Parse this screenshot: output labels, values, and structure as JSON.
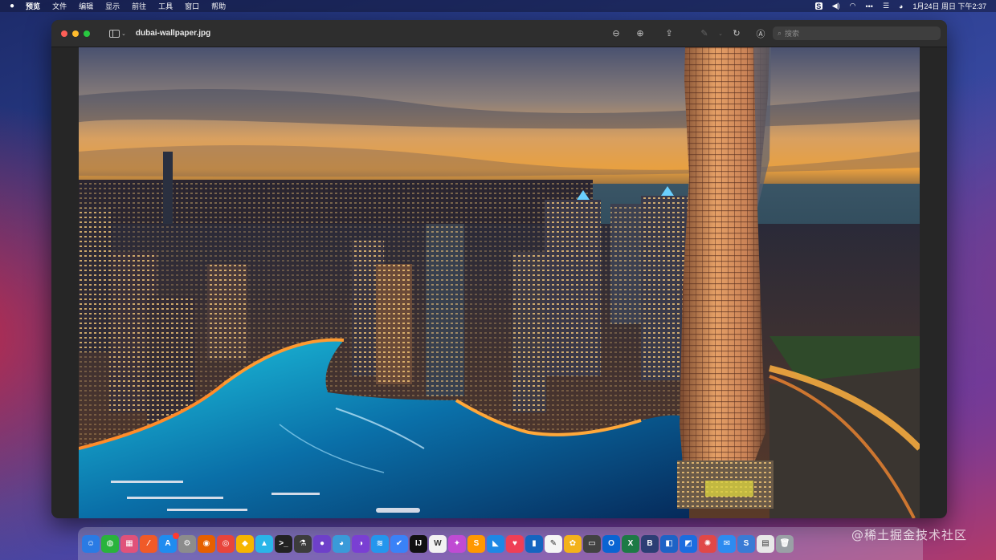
{
  "menubar": {
    "items": [
      "预览",
      "文件",
      "编辑",
      "显示",
      "前往",
      "工具",
      "窗口",
      "帮助"
    ],
    "clock": "1月24日 周日 下午2:37",
    "status_icons": [
      "s-menu-icon",
      "volume-icon",
      "wifi-icon",
      "more-dots-icon",
      "control-center-icon",
      "siri-icon"
    ]
  },
  "window": {
    "title": "dubai-wallpaper.jpg",
    "toolbar": {
      "zoom_out": "⊖",
      "zoom_in": "⊕",
      "share": "⇪",
      "markup": "✎",
      "rotate": "↻",
      "annotate": "Ⓐ"
    },
    "search": {
      "placeholder": "搜索"
    }
  },
  "dock": {
    "items": [
      {
        "name": "finder",
        "glyph": "☺",
        "color": "#2a7be4"
      },
      {
        "name": "wechat",
        "glyph": "◍",
        "color": "#29b33c"
      },
      {
        "name": "launchpad",
        "glyph": "▦",
        "color": "#e0527a"
      },
      {
        "name": "swift-playgrounds",
        "glyph": "⁄",
        "color": "#f05a28"
      },
      {
        "name": "app-store",
        "glyph": "A",
        "color": "#1f8cf0"
      },
      {
        "name": "system-preferences",
        "glyph": "⚙",
        "color": "#8c8c8c"
      },
      {
        "name": "firefox",
        "glyph": "◉",
        "color": "#e66000"
      },
      {
        "name": "chrome",
        "glyph": "◎",
        "color": "#e8453c"
      },
      {
        "name": "sketch",
        "glyph": "◆",
        "color": "#f7b500"
      },
      {
        "name": "affinity",
        "glyph": "▲",
        "color": "#2ab5e8"
      },
      {
        "name": "terminal",
        "glyph": ">_",
        "color": "#222222"
      },
      {
        "name": "flask",
        "glyph": "⚗",
        "color": "#3c3c3c"
      },
      {
        "name": "github",
        "glyph": "●",
        "color": "#6e40c9"
      },
      {
        "name": "qq",
        "glyph": "◕",
        "color": "#3a9ad9"
      },
      {
        "name": "firefox-dev",
        "glyph": "◑",
        "color": "#7a3fd3"
      },
      {
        "name": "docker",
        "glyph": "≋",
        "color": "#2496ed"
      },
      {
        "name": "things",
        "glyph": "✔",
        "color": "#3a82f7"
      },
      {
        "name": "intellij",
        "glyph": "IJ",
        "color": "#111111"
      },
      {
        "name": "typora",
        "glyph": "W",
        "color": "#f2f2f2"
      },
      {
        "name": "nova",
        "glyph": "✦",
        "color": "#c04bd3"
      },
      {
        "name": "sublime",
        "glyph": "S",
        "color": "#ff9800"
      },
      {
        "name": "vscode",
        "glyph": "◣",
        "color": "#1e88e5"
      },
      {
        "name": "pocket",
        "glyph": "♥",
        "color": "#ef3f56"
      },
      {
        "name": "bookmarks",
        "glyph": "▮",
        "color": "#1565c0"
      },
      {
        "name": "notes",
        "glyph": "✎",
        "color": "#f5f5f5"
      },
      {
        "name": "tes",
        "glyph": "✿",
        "color": "#f3b21b"
      },
      {
        "name": "screen",
        "glyph": "▭",
        "color": "#424242"
      },
      {
        "name": "outlook",
        "glyph": "O",
        "color": "#0a64d2"
      },
      {
        "name": "excel",
        "glyph": "X",
        "color": "#1d7a45"
      },
      {
        "name": "bbedit",
        "glyph": "B",
        "color": "#2c3e74"
      },
      {
        "name": "tasks",
        "glyph": "◧",
        "color": "#1e63c6"
      },
      {
        "name": "keynote",
        "glyph": "◩",
        "color": "#1b6de0"
      },
      {
        "name": "photo-booth",
        "glyph": "✺",
        "color": "#e04848"
      },
      {
        "name": "mail",
        "glyph": "✉",
        "color": "#2d8bf0"
      },
      {
        "name": "scrivener",
        "glyph": "S",
        "color": "#3a7bd5"
      },
      {
        "name": "preview-folder",
        "glyph": "▤",
        "color": "#e8e8e8"
      },
      {
        "name": "trash",
        "glyph": "🗑",
        "color": "#9aa0a6"
      }
    ]
  },
  "watermark": "@稀土掘金技术社区"
}
